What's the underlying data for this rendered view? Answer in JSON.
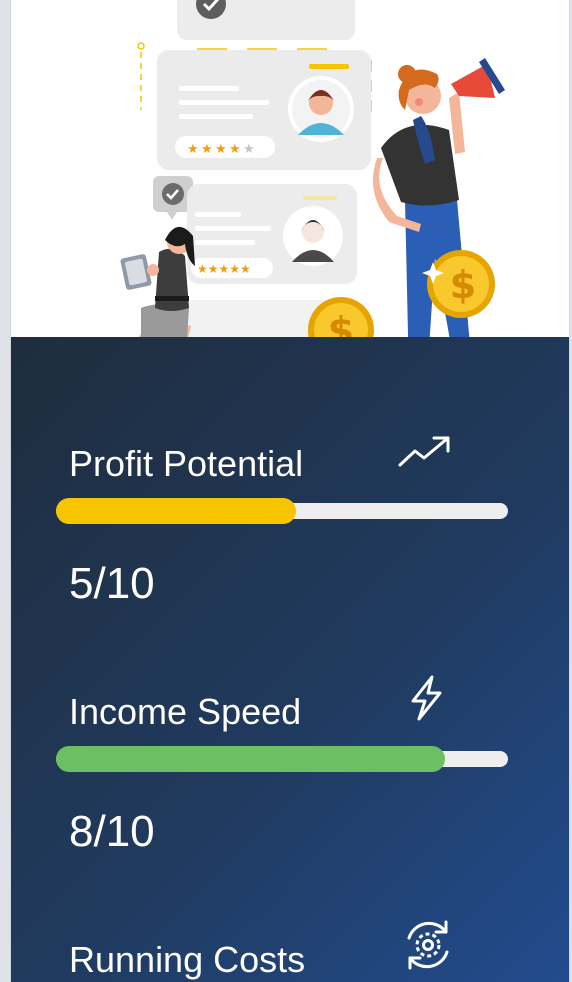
{
  "metrics": [
    {
      "label": "Profit Potential",
      "value_text": "5/10",
      "progress": 0.53,
      "color": "#f6c500",
      "icon": "trending-up-icon"
    },
    {
      "label": "Income Speed",
      "value_text": "8/10",
      "progress": 0.86,
      "color": "#6cbf62",
      "icon": "lightning-icon"
    },
    {
      "label": "Running Costs",
      "icon": "gear-refresh-icon"
    }
  ]
}
